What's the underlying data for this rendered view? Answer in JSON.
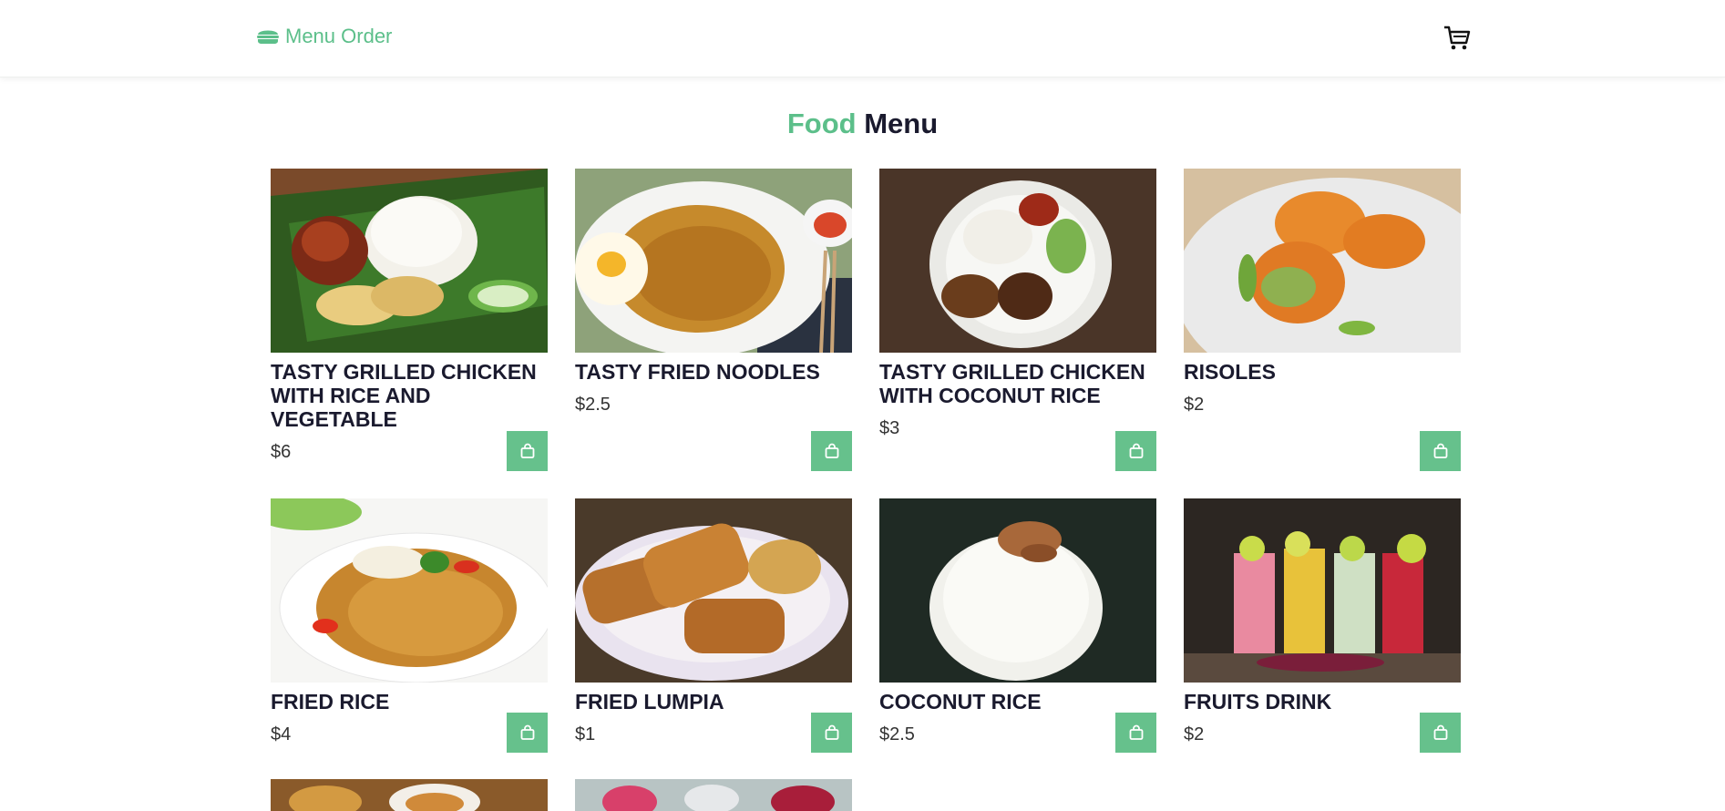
{
  "nav": {
    "brand": "Menu Order",
    "brand_icon": "burger-icon",
    "cart_icon": "cart-icon",
    "accent": "#5cbf8a"
  },
  "heading": {
    "accent": "Food",
    "rest": "Menu"
  },
  "items": [
    {
      "title": "TASTY GRILLED CHICKEN WITH RICE AND VEGETABLE",
      "price": "$6"
    },
    {
      "title": "TASTY FRIED NOODLES",
      "price": "$2.5"
    },
    {
      "title": "TASTY GRILLED CHICKEN WITH COCONUT RICE",
      "price": "$3"
    },
    {
      "title": "RISOLES",
      "price": "$2"
    },
    {
      "title": "FRIED RICE",
      "price": "$4"
    },
    {
      "title": "FRIED LUMPIA",
      "price": "$1"
    },
    {
      "title": "COCONUT RICE",
      "price": "$2.5"
    },
    {
      "title": "FRUITS DRINK",
      "price": "$2"
    }
  ],
  "button_color": "#66c18c"
}
